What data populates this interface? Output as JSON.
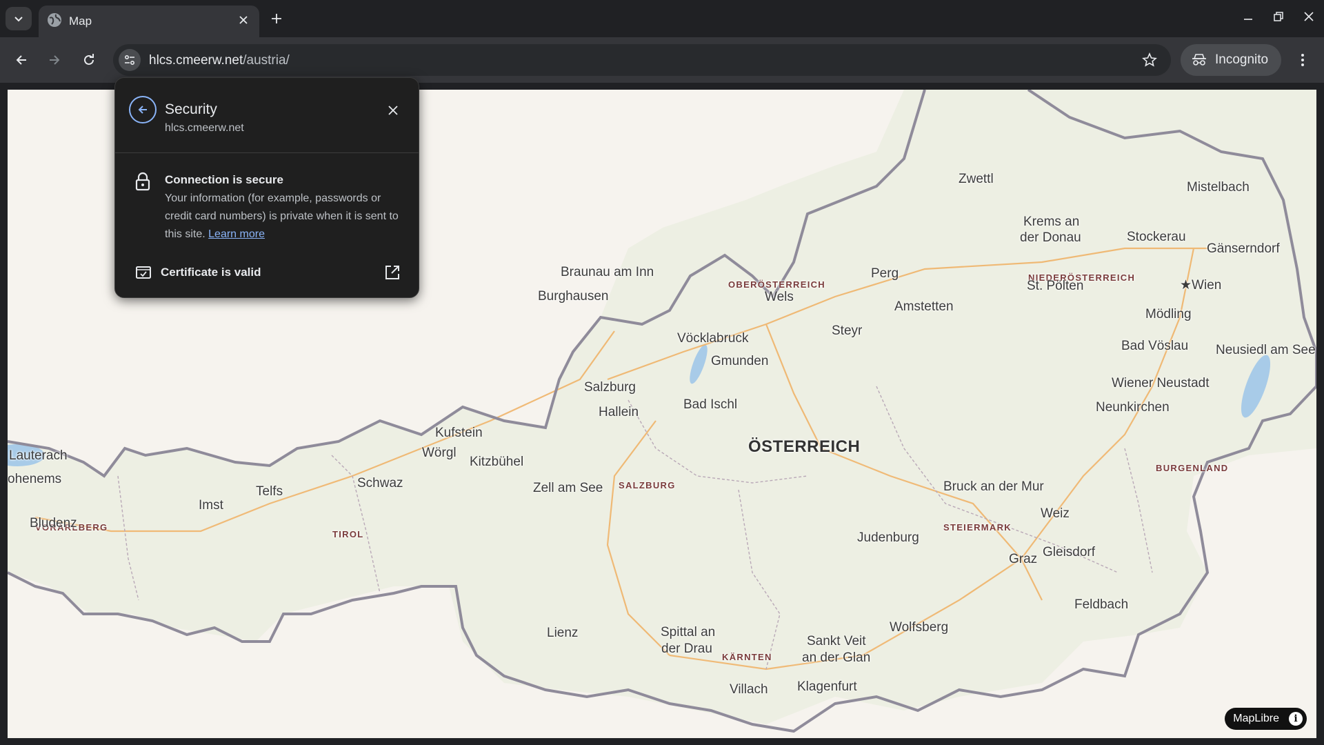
{
  "tab": {
    "title": "Map"
  },
  "omnibox": {
    "host": "hlcs.cmeerw.net",
    "path": "/austria/"
  },
  "incognito_label": "Incognito",
  "security_popup": {
    "title": "Security",
    "domain": "hlcs.cmeerw.net",
    "connection_heading": "Connection is secure",
    "connection_text": "Your information (for example, passwords or credit card numbers) is private when it is sent to this site.",
    "learn_more": "Learn more",
    "certificate": "Certificate is valid"
  },
  "map": {
    "attribution": "MapLibre",
    "country_label": "ÖSTERREICH",
    "regions": [
      "OBERÖSTERREICH",
      "NIEDERÖSTERREICH",
      "SALZBURG",
      "TIROL",
      "VORARLBERG",
      "STEIERMARK",
      "BURGENLAND",
      "KÄRNTEN"
    ],
    "cities": [
      "Zwettl",
      "Mistelbach",
      "Krems an",
      "der Donau",
      "Stockerau",
      "Gänserndorf",
      "Braunau am Inn",
      "Burghausen",
      "Perg",
      "Wels",
      "Amstetten",
      "St. Pölten",
      "★Wien",
      "Mödling",
      "Steyr",
      "Vöcklabruck",
      "Gmunden",
      "Bad Vöslau",
      "Neusiedl am See",
      "Salzburg",
      "Hallein",
      "Bad Ischl",
      "Wiener Neustadt",
      "Neunkirchen",
      "Kufstein",
      "Wörgl",
      "Kitzbühel",
      "Lauterach",
      "ohenems",
      "Schwaz",
      "Zell am See",
      "Telfs",
      "Imst",
      "Bludenz",
      "Bruck an der Mur",
      "Judenburg",
      "Weiz",
      "Gleisdorf",
      "Graz",
      "Feldbach",
      "Lienz",
      "Spittal an",
      "der Drau",
      "Sankt Veit",
      "an der Glan",
      "Wolfsberg",
      "Villach",
      "Klagenfurt"
    ]
  }
}
